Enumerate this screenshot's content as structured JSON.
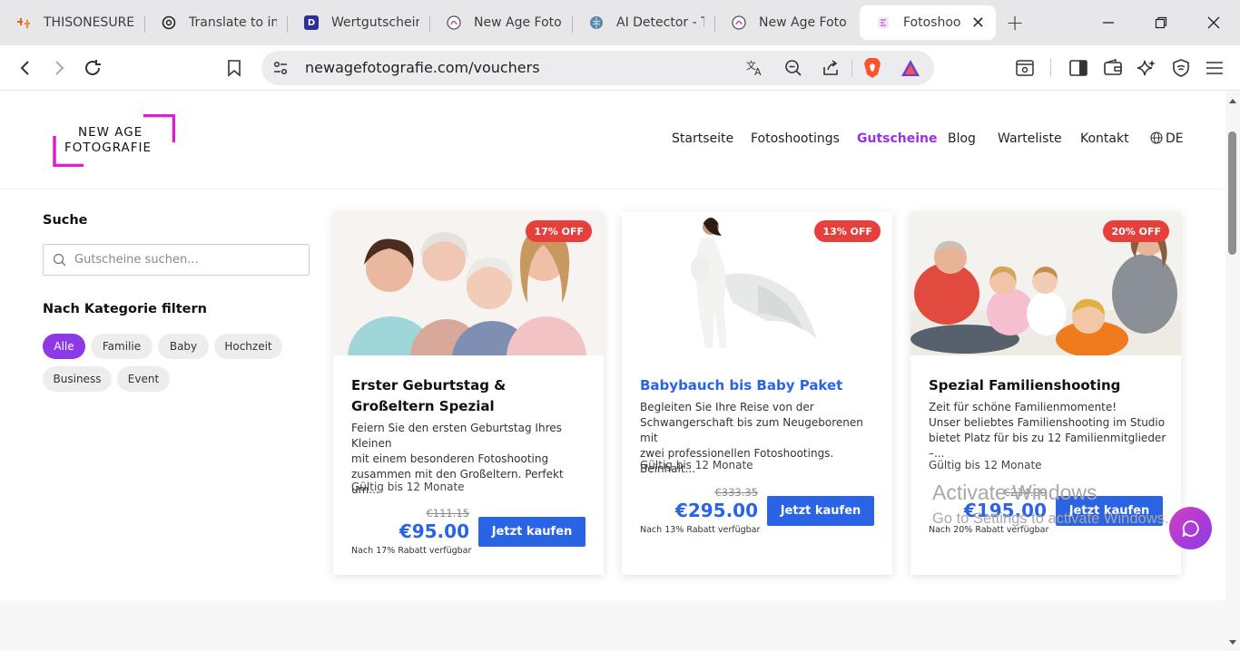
{
  "browser": {
    "tabs": [
      {
        "title": "THISONESURE",
        "icon": "orange-brand-icon"
      },
      {
        "title": "Translate to int",
        "icon": "openai-icon"
      },
      {
        "title": "Wertgutschein",
        "icon": "d-letter-icon"
      },
      {
        "title": "New Age Foto",
        "icon": "site-icon"
      },
      {
        "title": "AI Detector - T",
        "icon": "brain-icon"
      },
      {
        "title": "New Age Foto",
        "icon": "site-icon"
      },
      {
        "title": "Fotoshoo",
        "icon": "site-icon",
        "active": true
      }
    ],
    "url": "newagefotografie.com/vouchers"
  },
  "site": {
    "logo_line1": "NEW AGE",
    "logo_line2": "FOTOGRAFIE",
    "nav": [
      "Startseite",
      "Fotoshootings",
      "Gutscheine",
      "Blog",
      "Warteliste",
      "Kontakt"
    ],
    "nav_active": "Gutscheine",
    "language": "DE"
  },
  "sidebar": {
    "search_heading": "Suche",
    "search_placeholder": "Gutscheine suchen...",
    "filter_heading": "Nach Kategorie filtern",
    "categories": [
      "Alle",
      "Familie",
      "Baby",
      "Hochzeit",
      "Business",
      "Event"
    ],
    "active_category": "Alle"
  },
  "vouchers": [
    {
      "badge": "17% OFF",
      "title": "Erster Geburtstag & Großeltern Spezial",
      "description": "Feiern Sie den ersten Geburtstag Ihres Kleinen\nmit einem besonderen Fotoshooting\nzusammen mit den Großeltern. Perfekt um...",
      "validity": "Gültig bis 12 Monate",
      "old_price": "€111.15",
      "price": "€95.00",
      "note": "Nach 17% Rabatt verfügbar",
      "button": "Jetzt kaufen"
    },
    {
      "badge": "13% OFF",
      "title": "Babybauch bis Baby Paket",
      "description": "Begleiten Sie Ihre Reise von der\nSchwangerschaft bis zum Neugeborenen mit\nzwei professionellen Fotoshootings. Beinhalt...",
      "validity": "Gültig bis 12 Monate",
      "old_price": "€333.35",
      "price": "€295.00",
      "note": "Nach 13% Rabatt verfügbar",
      "button": "Jetzt kaufen"
    },
    {
      "badge": "20% OFF",
      "title": "Spezial Familienshooting",
      "description": "Zeit für schöne Familienmomente!\nUnser beliebtes Familienshooting im Studio\nbietet Platz für bis zu 12 Familienmitglieder –...",
      "validity": "Gültig bis 12 Monate",
      "old_price": "€234.00",
      "price": "€195.00",
      "note": "Nach 20% Rabatt verfügbar",
      "button": "Jetzt kaufen"
    }
  ],
  "overlay": {
    "activate_title": "Activate Windows",
    "activate_sub": "Go to Settings to activate Windows."
  }
}
